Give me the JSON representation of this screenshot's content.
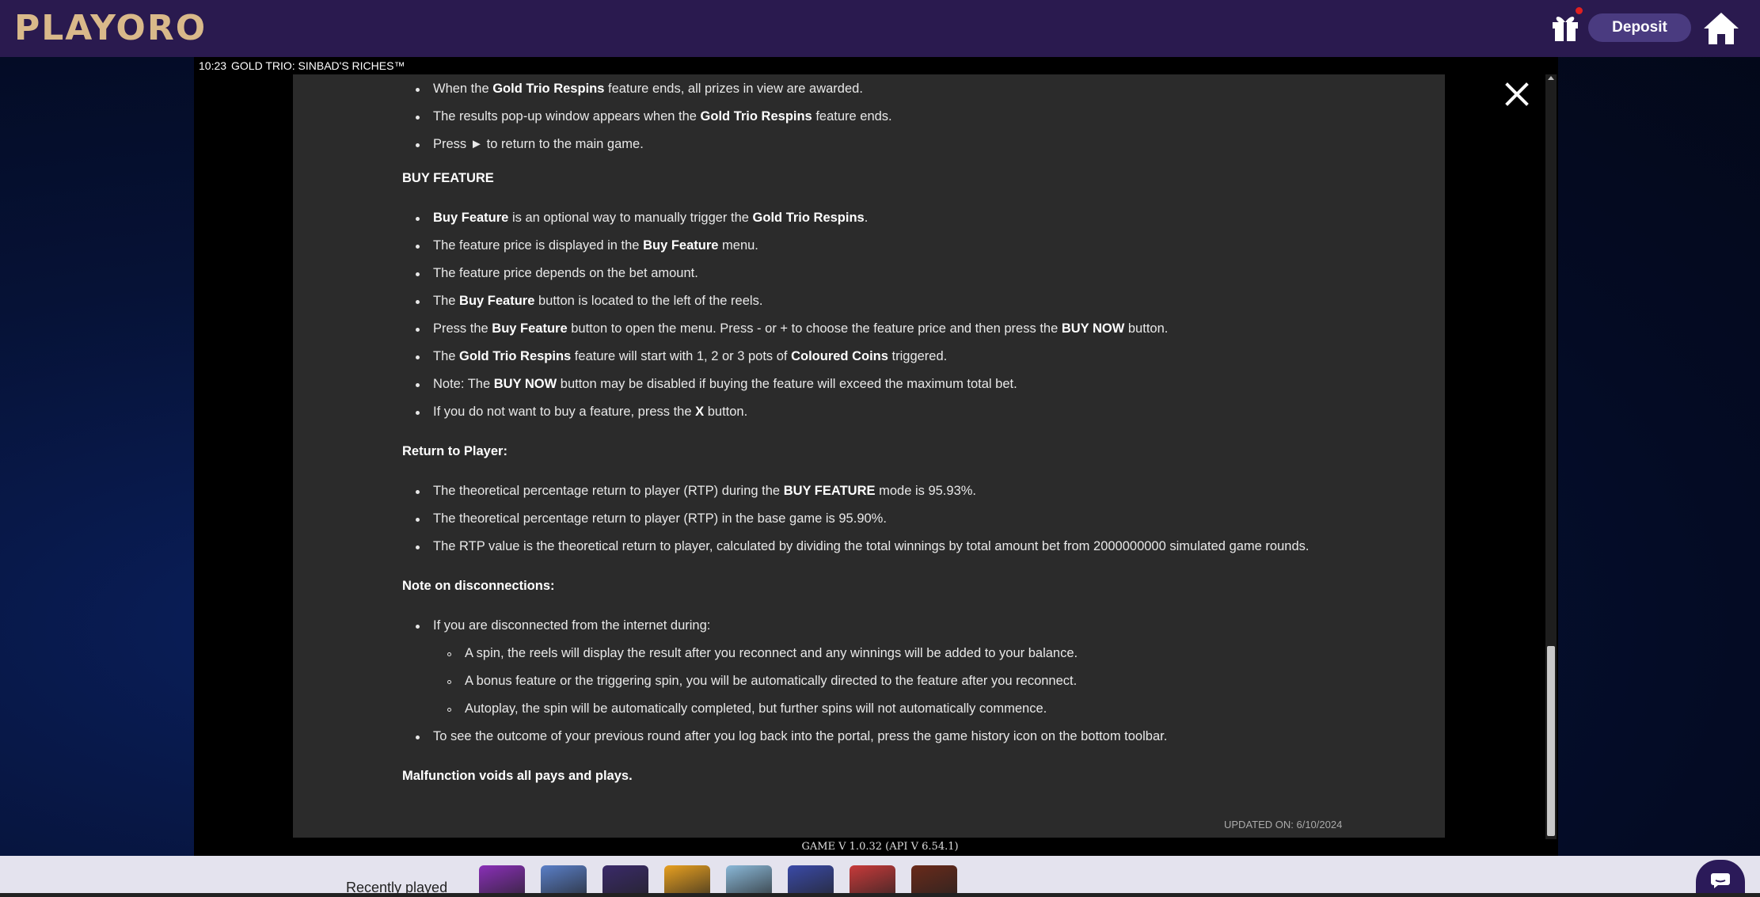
{
  "header": {
    "logo_text": "PLAYORO",
    "deposit_label": "Deposit",
    "gift_badge": true
  },
  "game": {
    "time": "10:23",
    "title": "GOLD TRIO: SINBAD'S RICHES™",
    "version": "GAME V 1.0.32 (API V 6.54.1)",
    "updated": "UPDATED ON:  6/10/2024"
  },
  "help": {
    "respins_items": [
      [
        "When the ",
        {
          "b": "Gold Trio Respins"
        },
        " feature ends, all prizes in view are awarded."
      ],
      [
        "The results pop-up window appears when the ",
        {
          "b": "Gold Trio Respins"
        },
        " feature ends."
      ],
      [
        "Press ► to return to the main game."
      ]
    ],
    "buy_heading": "BUY FEATURE",
    "buy_items": [
      [
        {
          "b": "Buy Feature"
        },
        " is an optional way to manually trigger the ",
        {
          "b": "Gold Trio Respins"
        },
        "."
      ],
      [
        "The feature price is displayed in the ",
        {
          "b": "Buy Feature"
        },
        " menu."
      ],
      [
        "The feature price depends on the bet amount."
      ],
      [
        "The ",
        {
          "b": "Buy Feature"
        },
        " button is located to the left of the reels."
      ],
      [
        "Press the ",
        {
          "b": "Buy Feature"
        },
        " button to open the menu. Press - or + to choose the feature price and then press the ",
        {
          "b": "BUY NOW"
        },
        " button."
      ],
      [
        "The ",
        {
          "b": "Gold Trio Respins"
        },
        " feature will start with 1, 2 or 3 pots of ",
        {
          "b": "Coloured Coins"
        },
        " triggered."
      ],
      [
        "Note: The ",
        {
          "b": "BUY NOW"
        },
        " button may be disabled if buying the feature will exceed the maximum total bet."
      ],
      [
        "If you do not want to buy a feature, press the ",
        {
          "b": "X"
        },
        " button."
      ]
    ],
    "rtp_heading": "Return to Player:",
    "rtp_items": [
      [
        "The theoretical percentage return to player (RTP) during the ",
        {
          "b": "BUY FEATURE"
        },
        " mode is 95.93%."
      ],
      [
        "The theoretical percentage return to player (RTP) in the base game is 95.90%."
      ],
      [
        "The RTP value is the theoretical return to player, calculated by dividing the total winnings by total amount bet from 2000000000 simulated game rounds."
      ]
    ],
    "disc_heading": "Note on disconnections:",
    "disc_item": "If you are disconnected from the internet during:",
    "disc_subitems": [
      "A spin, the reels will display the result after you reconnect and any winnings will be added to your balance.",
      "A bonus feature or the triggering spin, you will be automatically directed to the feature after you reconnect.",
      "Autoplay, the spin will be automatically completed, but further spins will not automatically commence."
    ],
    "disc_item2": "To see the outcome of your previous round after you log back into the portal, press the game history icon on the bottom toolbar.",
    "malfunction": "Malfunction voids all pays and plays."
  },
  "bottom": {
    "recently_played": "Recently played",
    "thumb_colors": [
      "#8a2fb8",
      "#5a7fc8",
      "#3a2a6a",
      "#e8a020",
      "#8ab8d8",
      "#3a4aa8",
      "#c83a3a",
      "#6a2a1a"
    ]
  },
  "colors": {
    "topbar": "#2a1a4f",
    "panel": "#2b2b2b",
    "deposit": "#4a3b80"
  }
}
